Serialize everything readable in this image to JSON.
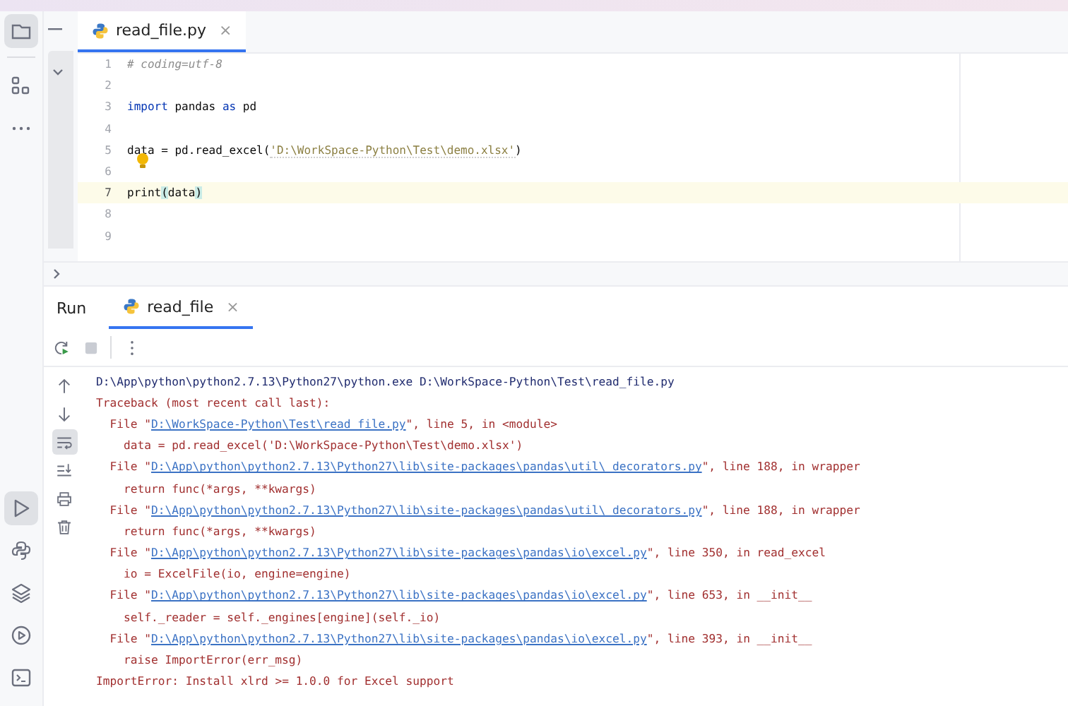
{
  "sidebar": {
    "top_tools": [
      {
        "kind": "folder",
        "selected": true
      },
      {
        "kind": "structure",
        "selected": false
      },
      {
        "kind": "more",
        "selected": false
      }
    ],
    "bottom_tools": [
      {
        "kind": "run",
        "selected": true
      },
      {
        "kind": "python",
        "selected": false
      },
      {
        "kind": "layers",
        "selected": false
      },
      {
        "kind": "services",
        "selected": false
      },
      {
        "kind": "terminal",
        "selected": false
      }
    ]
  },
  "editor": {
    "tabs": [
      {
        "label": "read_file.py",
        "selected": true,
        "close": "×"
      }
    ],
    "lines": [
      {
        "number": "1",
        "current": false,
        "tokens": [
          {
            "kind": "comment",
            "text": "# coding=utf-8"
          }
        ]
      },
      {
        "number": "2",
        "current": false
      },
      {
        "number": "3",
        "current": false,
        "tokens": [
          {
            "kind": "keyword",
            "text": "import"
          },
          {
            "kind": "plain",
            "text": " pandas "
          },
          {
            "kind": "keyword",
            "text": "as"
          },
          {
            "kind": "plain",
            "text": " pd"
          }
        ]
      },
      {
        "number": "4",
        "current": false
      },
      {
        "number": "5",
        "current": false,
        "tokens": [
          {
            "kind": "plain",
            "text": "data = pd.read_excel("
          },
          {
            "kind": "string",
            "text": "'D:\\WorkSpace-Python\\Test\\demo.xlsx'"
          },
          {
            "kind": "plain",
            "text": ")"
          }
        ]
      },
      {
        "number": "6",
        "current": false,
        "bulb": true
      },
      {
        "number": "7",
        "current": true,
        "tokens": [
          {
            "kind": "plain",
            "text": "print"
          },
          {
            "kind": "brace",
            "text": "("
          },
          {
            "kind": "plain",
            "text": "data"
          },
          {
            "kind": "brace",
            "text": ")"
          }
        ]
      },
      {
        "number": "8",
        "current": false
      },
      {
        "number": "9",
        "current": false
      }
    ]
  },
  "run": {
    "title": "Run",
    "tabs": [
      {
        "label": "read_file",
        "selected": true,
        "close": "×"
      }
    ],
    "toolbar": [
      {
        "kind": "rerun",
        "disabled": false
      },
      {
        "kind": "stop",
        "disabled": true
      },
      {
        "kind": "more",
        "disabled": false
      }
    ],
    "side_tools": [
      {
        "kind": "up",
        "selected": false
      },
      {
        "kind": "down",
        "selected": false
      },
      {
        "kind": "wrap",
        "selected": true
      },
      {
        "kind": "scroll_end",
        "selected": false
      },
      {
        "kind": "print",
        "selected": false
      },
      {
        "kind": "trash",
        "selected": false
      }
    ],
    "console": [
      {
        "kind": "command",
        "text": "D:\\App\\python\\python2.7.13\\Python27\\python.exe D:\\WorkSpace-Python\\Test\\read_file.py"
      },
      {
        "kind": "error",
        "text": "Traceback (most recent call last):"
      },
      {
        "kind": "frame",
        "prefix": "File \"",
        "link": "D:\\WorkSpace-Python\\Test\\read_file.py",
        "suffix": "\", line 5, in <module>"
      },
      {
        "kind": "source",
        "text": "data = pd.read_excel('D:\\WorkSpace-Python\\Test\\demo.xlsx')"
      },
      {
        "kind": "frame",
        "prefix": "File \"",
        "link": "D:\\App\\python\\python2.7.13\\Python27\\lib\\site-packages\\pandas\\util\\_decorators.py",
        "suffix": "\", line 188, in wrapper"
      },
      {
        "kind": "source",
        "text": "return func(*args, **kwargs)"
      },
      {
        "kind": "frame",
        "prefix": "File \"",
        "link": "D:\\App\\python\\python2.7.13\\Python27\\lib\\site-packages\\pandas\\util\\_decorators.py",
        "suffix": "\", line 188, in wrapper"
      },
      {
        "kind": "source",
        "text": "return func(*args, **kwargs)"
      },
      {
        "kind": "frame",
        "prefix": "File \"",
        "link": "D:\\App\\python\\python2.7.13\\Python27\\lib\\site-packages\\pandas\\io\\excel.py",
        "suffix": "\", line 350, in read_excel"
      },
      {
        "kind": "source",
        "text": "io = ExcelFile(io, engine=engine)"
      },
      {
        "kind": "frame",
        "prefix": "File \"",
        "link": "D:\\App\\python\\python2.7.13\\Python27\\lib\\site-packages\\pandas\\io\\excel.py",
        "suffix": "\", line 653, in __init__"
      },
      {
        "kind": "source",
        "text": "self._reader = self._engines[engine](self._io)"
      },
      {
        "kind": "frame",
        "prefix": "File \"",
        "link": "D:\\App\\python\\python2.7.13\\Python27\\lib\\site-packages\\pandas\\io\\excel.py",
        "suffix": "\", line 393, in __init__"
      },
      {
        "kind": "source",
        "text": "raise ImportError(err_msg)"
      },
      {
        "kind": "error",
        "text": "ImportError: Install xlrd >= 1.0.0 for Excel support"
      }
    ]
  }
}
